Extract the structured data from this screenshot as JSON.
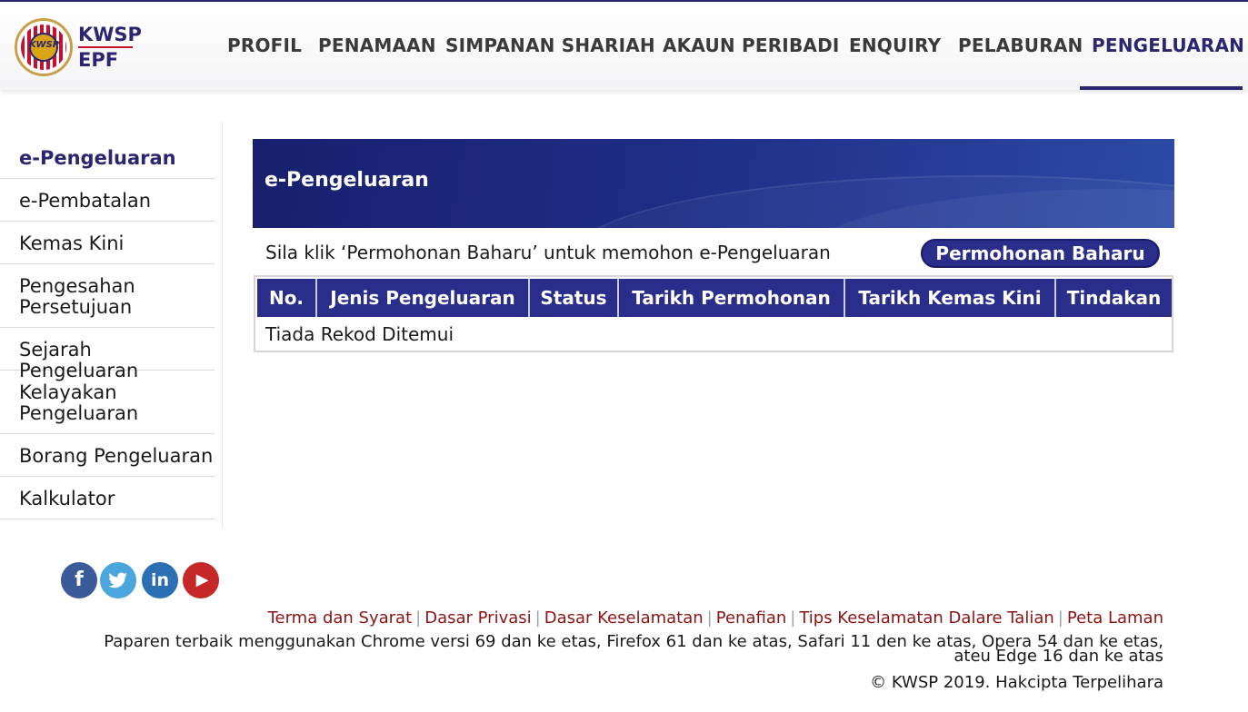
{
  "header": {
    "logo_text_top": "KWSP",
    "logo_text_bottom": "EPF",
    "logo_seal_text": "KWSP",
    "nav": [
      {
        "label": "PROFIL"
      },
      {
        "label": "PENAMAAN"
      },
      {
        "label": "SIMPANAN SHARIAH"
      },
      {
        "label": "AKAUN PERIBADI"
      },
      {
        "label": "ENQUIRY"
      },
      {
        "label": "PELABURAN"
      },
      {
        "label": "PENGELUARAN",
        "active": true
      }
    ]
  },
  "sidebar": {
    "items": [
      {
        "label": "e-Pengeluaran",
        "active": true
      },
      {
        "label": "e-Pembatalan"
      },
      {
        "label": "Kemas Kini"
      },
      {
        "label": "Pengesahan Persetujuan"
      },
      {
        "label": "Sejarah Pengeluaran"
      },
      {
        "label": "Kelayakan Pengeluaran"
      },
      {
        "label": "Borang Pengeluaran"
      },
      {
        "label": "Kalkulator"
      }
    ]
  },
  "main": {
    "banner_title": "e-Pengeluaran",
    "instruction": "Sila klik ‘Permohonan Baharu’ untuk memohon e-Pengeluaran",
    "new_button": "Permohonan Baharu",
    "table": {
      "columns": [
        "No.",
        "Jenis Pengeluaran",
        "Status",
        "Tarikh Permohonan",
        "Tarikh Kemas Kini",
        "Tindakan"
      ],
      "empty_message": "Tiada Rekod Ditemui"
    }
  },
  "footer": {
    "social": [
      {
        "name": "facebook-icon",
        "glyph": "f"
      },
      {
        "name": "twitter-icon",
        "glyph": "❧"
      },
      {
        "name": "linkedin-icon",
        "glyph": "in"
      },
      {
        "name": "youtube-icon",
        "glyph": "▶"
      }
    ],
    "links": [
      "Terma dan Syarat",
      "Dasar Privasi",
      "Dasar Keselamatan",
      "Penafian",
      "Tips Keselamatan Dalare Talian",
      "Peta Laman"
    ],
    "link_separator": "|",
    "browser_note": "Paparen terbaik menggunakan Chrome versi 69 dan ke etas, Firefox 61 dan ke atas, Safari 11 den ke atas, Opera 54 dan ke etas, ateu Edge 16 dan ke atas",
    "copyright": "© KWSP 2019. Hakcipta Terpelihara"
  },
  "colors": {
    "brand_navy": "#2a2670",
    "table_header": "#2a2d8a",
    "footer_link": "#8c1414"
  }
}
